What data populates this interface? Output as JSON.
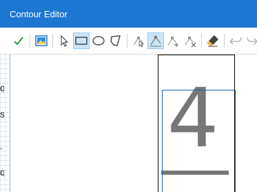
{
  "window": {
    "title": "Contour Editor"
  },
  "toolbar": {
    "buttons": [
      {
        "name": "accept-icon",
        "color": "#2e9d45"
      },
      {
        "name": "image-icon",
        "color": "#1c77d3"
      },
      {
        "name": "select-pointer-icon"
      },
      {
        "name": "rectangle-tool-icon",
        "active": true
      },
      {
        "name": "ellipse-tool-icon"
      },
      {
        "name": "polygon-tool-icon"
      },
      {
        "name": "node-edit-icon"
      },
      {
        "name": "node-move-icon",
        "active": true
      },
      {
        "name": "add-node-icon"
      },
      {
        "name": "delete-node-icon"
      },
      {
        "name": "eraser-icon"
      },
      {
        "name": "undo-icon"
      },
      {
        "name": "redo-icon"
      }
    ]
  },
  "background": {
    "chars": [
      "q",
      "s",
      ".",
      "q"
    ]
  },
  "canvas": {
    "glyph": "4",
    "glyph_color": "#777777",
    "selection_color": "#1a5fb4"
  }
}
